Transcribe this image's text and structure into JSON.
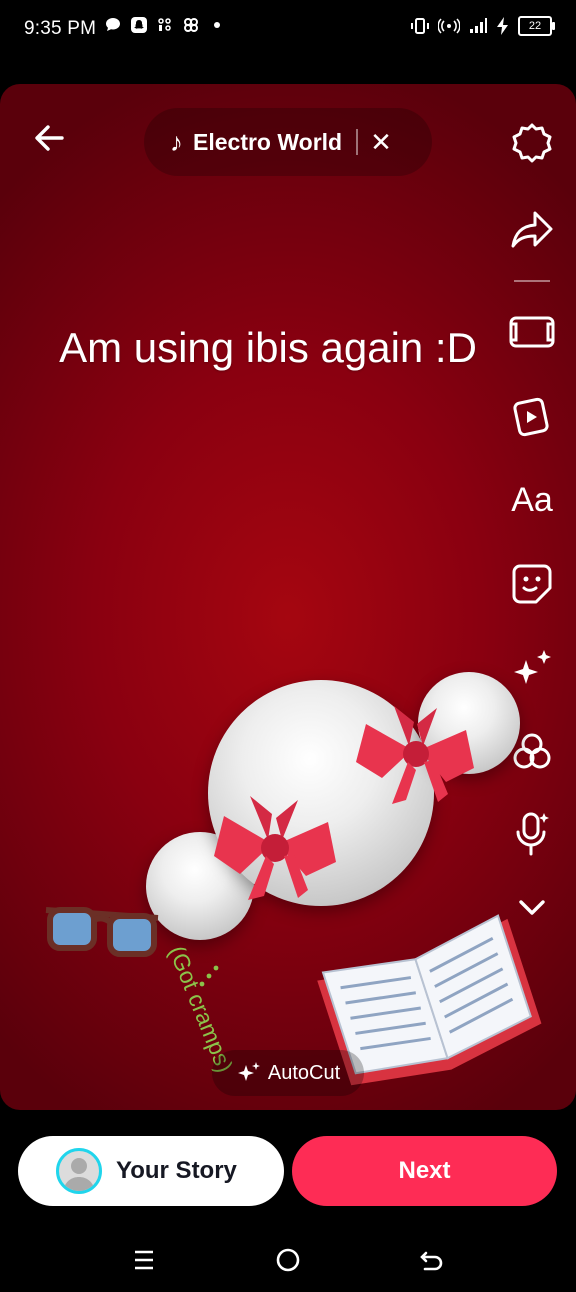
{
  "status_bar": {
    "time": "9:35 PM",
    "battery": "22",
    "left_icons": [
      "message-icon",
      "snapchat-icon",
      "app-icon",
      "network-icon",
      "dot-icon"
    ],
    "right_icons": [
      "vibrate-icon",
      "hotspot-icon",
      "signal-icon",
      "charging-icon",
      "battery-icon"
    ]
  },
  "editor": {
    "music_title": "Electro World",
    "overlay_text": "Am using ibis again :D",
    "sticker_text": "(Got cramps)",
    "autocut_label": "AutoCut",
    "toolbar": [
      "settings-icon",
      "share-icon",
      "frame-icon",
      "templates-icon",
      "text-icon",
      "sticker-icon",
      "effects-icon",
      "filters-icon",
      "voice-icon",
      "chevron-down-icon"
    ],
    "text_tool_label": "Aa"
  },
  "actions": {
    "your_story": "Your Story",
    "next": "Next"
  },
  "colors": {
    "accent": "#fe2c55",
    "story_ring": "#20d5ec",
    "background_red": "#8a0010"
  }
}
